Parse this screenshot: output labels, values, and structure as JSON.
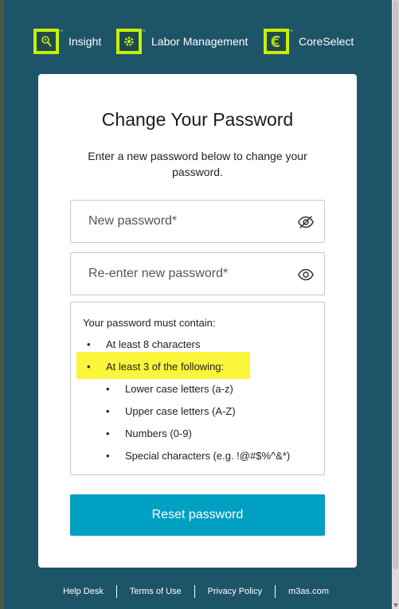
{
  "brands": [
    {
      "name": "Insight",
      "icon": "insight-icon"
    },
    {
      "name": "Labor Management",
      "icon": "labor-management-gear-icon"
    },
    {
      "name": "CoreSelect",
      "icon": "coreselect-icon"
    }
  ],
  "brand_tm": "™",
  "card": {
    "title": "Change Your Password",
    "subtitle": "Enter a new password below to change your password.",
    "new_password": {
      "placeholder": "New password*",
      "value": "",
      "icon": "eye-slash-icon"
    },
    "reenter_password": {
      "placeholder": "Re-enter new password*",
      "value": "",
      "icon": "eye-icon"
    },
    "rules": {
      "intro": "Your password must contain:",
      "bullet": "•",
      "items": [
        "At least 8 characters",
        "At least 3 of the following:"
      ],
      "sub_items": [
        "Lower case letters (a-z)",
        "Upper case letters (A-Z)",
        "Numbers (0-9)",
        "Special characters (e.g. !@#$%^&*)"
      ]
    },
    "reset_label": "Reset password"
  },
  "footer": {
    "links": [
      "Help Desk",
      "Terms of Use",
      "Privacy Policy",
      "m3as.com"
    ]
  },
  "colors": {
    "background": "#1e5468",
    "card": "#ffffff",
    "accent": "#00a0c2",
    "brand_green": "#c7f000",
    "highlight": "#fbf63a"
  }
}
